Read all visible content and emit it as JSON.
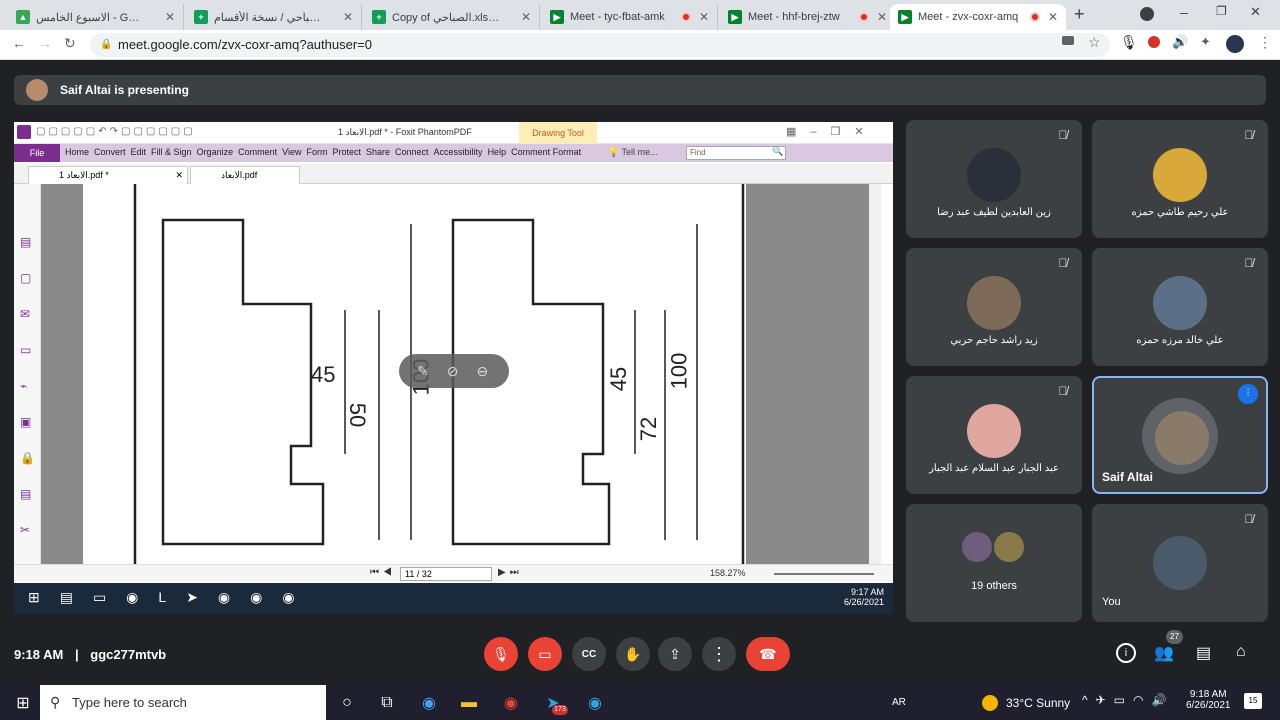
{
  "browser": {
    "tabs": [
      {
        "title": "الاسبوع الخامس - Google Drive",
        "icon": "drive-icon",
        "color": "#34a853"
      },
      {
        "title": "الصباحي / نسخة الأقسام - Sheets",
        "icon": "sheets-icon",
        "color": "#0f9d58"
      },
      {
        "title": "Copy of الصباحي.xlsx - Google",
        "icon": "sheets-icon",
        "color": "#0f9d58"
      },
      {
        "title": "Meet - tyc-fbat-amk",
        "icon": "meet-icon",
        "color": "#00832d"
      },
      {
        "title": "Meet - hhf-brej-ztw",
        "icon": "meet-icon",
        "color": "#00832d"
      },
      {
        "title": "Meet - zvx-coxr-amq",
        "icon": "meet-icon",
        "color": "#00832d"
      }
    ],
    "new_tab": "+",
    "url": "meet.google.com/zvx-coxr-amq?authuser=0"
  },
  "meet": {
    "presenting": "Saif Altai is presenting",
    "time": "9:18 AM",
    "separator": "|",
    "meeting_code": "ggc277mtvb",
    "people_count": "27",
    "participants": [
      {
        "name": "زين العابدين لطيف عبد رضا",
        "muted": true,
        "avatar": "#2a2f3a"
      },
      {
        "name": "علي رحيم طاشي حمزه",
        "muted": true,
        "avatar": "#d8a93a"
      },
      {
        "name": "زيد راشد حاجم حربي",
        "muted": true,
        "avatar": "#7e6a58"
      },
      {
        "name": "علي خالد مرزه حمزه",
        "muted": true,
        "avatar": "#5b6f86"
      },
      {
        "name": "عبد الجبار عبد السلام عبد الجبار",
        "muted": true,
        "avatar": "#e0a7a0"
      },
      {
        "name": "Saif Altai",
        "muted": false,
        "avatar": "#8a7a6a"
      },
      {
        "name": "19 others",
        "muted": false,
        "avatar": "#6f5d7e"
      },
      {
        "name": "You",
        "muted": true,
        "avatar": "#4a5a6a"
      }
    ]
  },
  "foxit": {
    "title": "الابعاد 1.pdf * - Foxit PhantomPDF",
    "drawing_tool": "Drawing Tool",
    "menu": [
      "Home",
      "Convert",
      "Edit",
      "Fill & Sign",
      "Organize",
      "Comment",
      "View",
      "Form",
      "Protect",
      "Share",
      "Connect",
      "Accessibility",
      "Help",
      "Comment Format"
    ],
    "file": "File",
    "tell_me": "Tell me...",
    "find_placeholder": "Find",
    "tabs": [
      "الابعاد 1.pdf *",
      "الابعاد.pdf"
    ],
    "page": "11 / 32",
    "zoom": "158.27%",
    "dims": [
      "45",
      "50",
      "100",
      "45",
      "72",
      "100"
    ],
    "taskbar_time": "9:17 AM",
    "taskbar_date": "6/26/2021"
  },
  "windows": {
    "search": "Type here to search",
    "weather": "33°C  Sunny",
    "lang": "AR",
    "time": "9:18 AM",
    "date": "6/26/2021",
    "badge": "173",
    "notif": "15"
  }
}
